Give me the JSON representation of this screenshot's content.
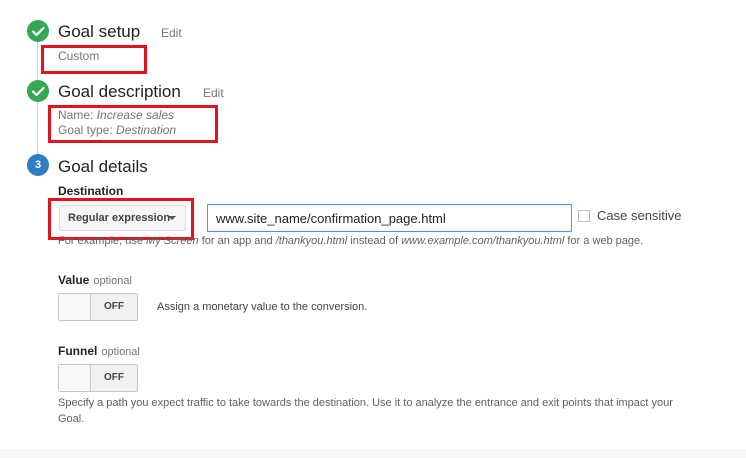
{
  "steps": [
    {
      "title": "Goal setup",
      "edit_label": "Edit",
      "summary": "Custom"
    },
    {
      "title": "Goal description",
      "edit_label": "Edit",
      "name_label": "Name:",
      "name_value": "Increase sales",
      "type_label": "Goal type:",
      "type_value": "Destination"
    },
    {
      "number": "3",
      "title": "Goal details"
    }
  ],
  "destination": {
    "label": "Destination",
    "match_type": "Regular expression",
    "value": "www.site_name/confirmation_page.html",
    "case_sensitive_label": "Case sensitive",
    "hint_prefix": "For example, use",
    "hint_example_1": "My Screen",
    "hint_middle_1": "for an app and",
    "hint_example_2": "/thankyou.html",
    "hint_middle_2": "instead of",
    "hint_example_3": "www.example.com/thankyou.html",
    "hint_suffix": "for a web page."
  },
  "value_section": {
    "label": "Value",
    "optional": "optional",
    "toggle_state": "OFF",
    "description": "Assign a monetary value to the conversion."
  },
  "funnel_section": {
    "label": "Funnel",
    "optional": "optional",
    "toggle_state": "OFF",
    "description": "Specify a path you expect traffic to take towards the destination. Use it to analyze the entrance and exit points that impact your Goal."
  },
  "colors": {
    "complete_step": "#34a853",
    "active_step": "#2f7ec4",
    "highlight_box": "#e0141c",
    "input_focus": "#4d90fe"
  },
  "icons": {
    "complete_step": "check-circle-icon",
    "dropdown": "caret-down-icon"
  }
}
